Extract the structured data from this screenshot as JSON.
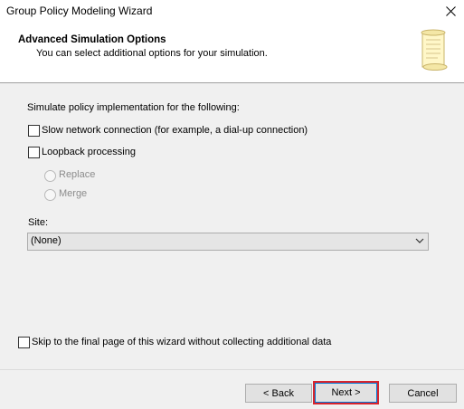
{
  "window": {
    "title": "Group Policy Modeling Wizard",
    "close_icon": "close-icon"
  },
  "header": {
    "title": "Advanced Simulation Options",
    "subtitle": "You can select additional options for your simulation.",
    "icon": "scroll-icon"
  },
  "options": {
    "intro": "Simulate policy implementation for the following:",
    "slow_network": {
      "label": "Slow network connection (for example, a dial-up connection)",
      "checked": false
    },
    "loopback": {
      "label": "Loopback processing",
      "checked": false
    },
    "loopback_modes": [
      {
        "label": "Replace",
        "selected": false,
        "enabled": false
      },
      {
        "label": "Merge",
        "selected": false,
        "enabled": false
      }
    ],
    "site_label": "Site:",
    "site_value": "(None)",
    "skip": {
      "label": "Skip to the final page of this wizard without collecting additional data",
      "checked": false
    }
  },
  "buttons": {
    "back": "< Back",
    "next": "Next >",
    "cancel": "Cancel"
  },
  "colors": {
    "highlight_border": "#d8242c",
    "focus_ring": "#0078d7"
  }
}
